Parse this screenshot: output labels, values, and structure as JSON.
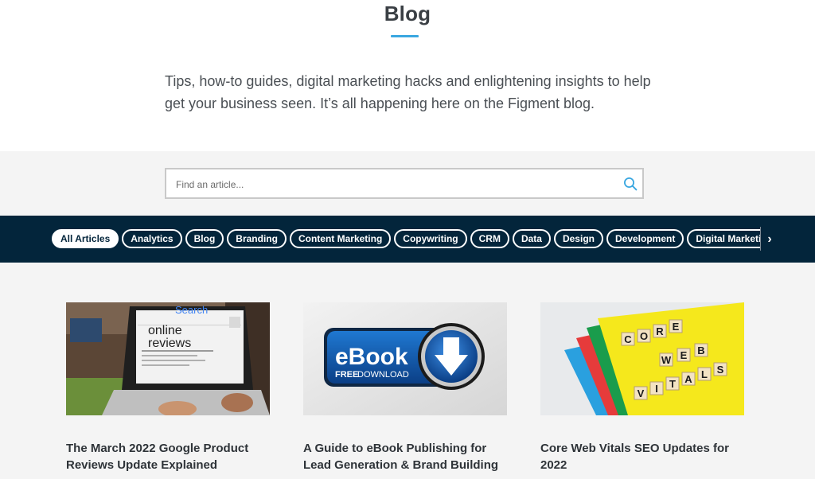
{
  "header": {
    "title": "Blog",
    "intro": "Tips, how-to guides, digital marketing hacks and enlightening insights to help get your business seen. It’s all happening here on the Figment blog."
  },
  "search": {
    "placeholder": "Find an article..."
  },
  "categories": {
    "items": [
      {
        "label": "All Articles",
        "active": true
      },
      {
        "label": "Analytics"
      },
      {
        "label": "Blog"
      },
      {
        "label": "Branding"
      },
      {
        "label": "Content Marketing"
      },
      {
        "label": "Copywriting"
      },
      {
        "label": "CRM"
      },
      {
        "label": "Data"
      },
      {
        "label": "Design"
      },
      {
        "label": "Development"
      },
      {
        "label": "Digital Marketing"
      }
    ],
    "next_icon": "chevron-right-icon"
  },
  "cards": [
    {
      "title": "The March 2022 Google Product Reviews Update Explained",
      "image": {
        "search_text": "Search",
        "headline": "online reviews"
      }
    },
    {
      "title": "A Guide to eBook Publishing for Lead Generation & Brand Building",
      "image": {
        "main": "eBook",
        "free": "FREE",
        "download": "DOWNLOAD"
      }
    },
    {
      "title": "Core Web Vitals SEO Updates for 2022",
      "image": {
        "word1": "CORE",
        "word2": "WEB",
        "word3": "VITALS"
      }
    }
  ],
  "colors": {
    "accent": "#3aa7e0",
    "nav_bg": "#03253b",
    "band_bg": "#f4f4f4"
  }
}
